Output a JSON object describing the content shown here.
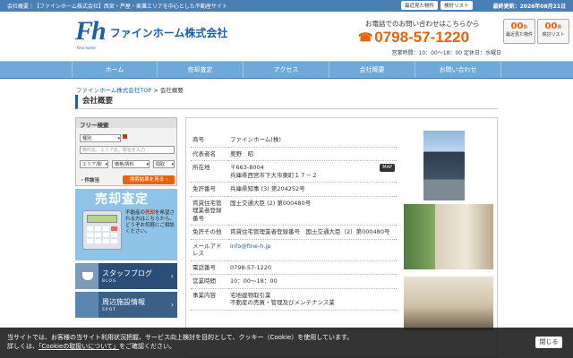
{
  "topbar": {
    "text": "会社概要｜【ファインホーム株式会社】西宮・芦屋・東灘エリアを中心とした不動産サイト",
    "updated": "最終更新：2026年08月21日"
  },
  "header": {
    "logo_mark": "Fh",
    "logo_sub": "Fine home",
    "company": "ファインホーム株式会社",
    "phone_label": "お電話でのお問い合わせはこちらから",
    "phone": "0798-57-1220",
    "hours": "営業時間：10：00～18：00 定休日：水曜日",
    "top_actions": [
      "最近見た物件",
      "検討リスト"
    ],
    "btns": [
      {
        "count": "00",
        "unit": "件",
        "label": "最近見た物件"
      },
      {
        "count": "00",
        "unit": "件",
        "label": "検討リスト"
      }
    ]
  },
  "nav": [
    "ホーム",
    "売却査定",
    "アクセス",
    "会社概要",
    "お問い合わせ"
  ],
  "breadcrumb": {
    "home": "ファインホーム株式会社TOP",
    "sep": ">",
    "current": "会社概要"
  },
  "page_title": "会社概要",
  "sidebar": {
    "search_title": "フリー検索",
    "type_select": "種別",
    "name_input": "物件名、エリア名、駅名を入力",
    "area_select": "エリア/駅",
    "price_select": "価格/賃料",
    "layout_select": "間取",
    "cond_link": "・件該当",
    "search_btn": "検索結果を見る ›",
    "sell": {
      "title": "売却査定",
      "text1": "不動産の",
      "text_red": "売却",
      "text2": "を希望される方はこちらから。どうぞお気軽にご相談ください。"
    },
    "banners": [
      {
        "title": "スタッフブログ",
        "sub": "BLOG"
      },
      {
        "title": "周辺施設情報",
        "sub": "SPOT"
      }
    ]
  },
  "company": {
    "rows": [
      {
        "k": "商号",
        "v": "ファインホーム(株)"
      },
      {
        "k": "代表者名",
        "v": "奥野　昭"
      },
      {
        "k": "所在地",
        "v": "〒663-8004\n兵庫県西宮市下大市東町１７－２"
      },
      {
        "k": "免許番号",
        "v": "兵庫県知事 (3) 第204252号"
      },
      {
        "k": "賃貸住宅管理業者登録番号",
        "v": "国土交通大臣 (2) 第000480号"
      },
      {
        "k": "免許その他",
        "v": "賃貸住宅管理業者登録番号　国土交通大臣（2）第000480号"
      },
      {
        "k": "メールアドレス",
        "v": "info@fine-h.jp"
      },
      {
        "k": "電話番号",
        "v": "0798-57-1220"
      },
      {
        "k": "営業時間",
        "v": "10：00～18：00"
      },
      {
        "k": "事業内容",
        "v": "宅地建物取引業\n不動産の売買・管理及びメンテナンス業"
      }
    ],
    "map_btn": "MAP"
  },
  "cookie": {
    "text1": "当サイトでは、お客様の当サイト利用状況把握、サービス向上検討を目的として、クッキー（Cookie）を使用しています。",
    "text2a": "詳しくは、",
    "link": "「Cookieの取扱いについて」",
    "text2b": "をご確認ください。",
    "close": "閉じる"
  }
}
